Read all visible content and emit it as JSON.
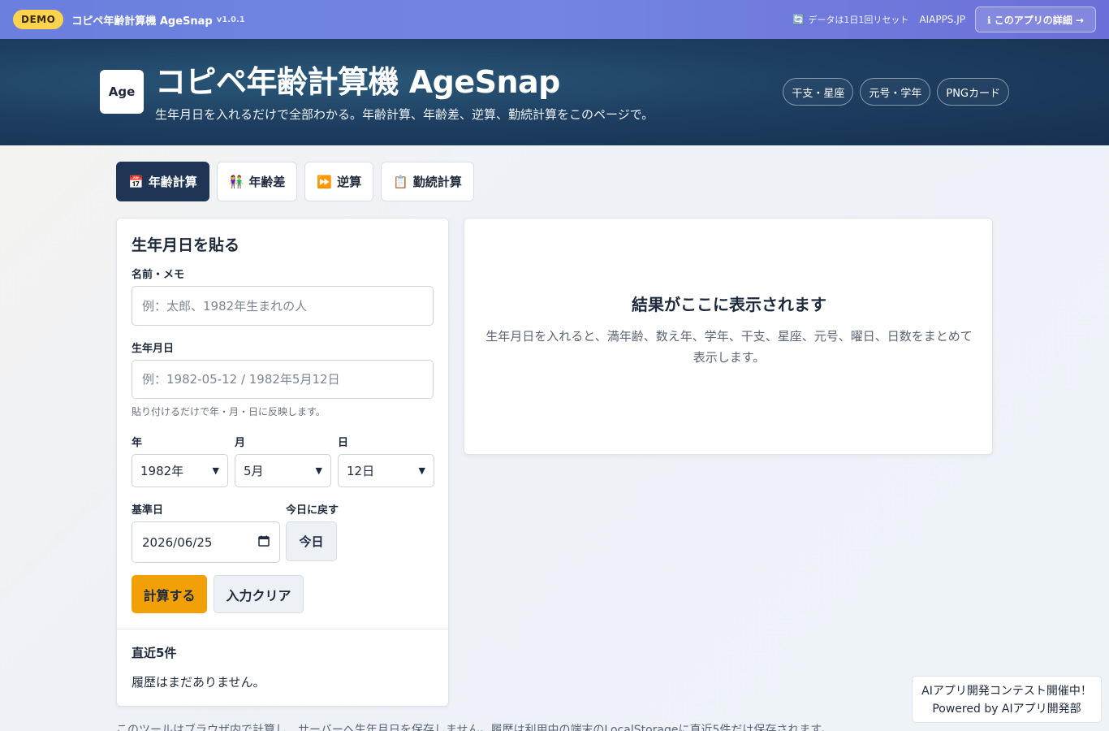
{
  "topbar": {
    "demo": "DEMO",
    "title": "コピペ年齢計算機 AgeSnap",
    "version": "v1.0.1",
    "reset_note": "データは1日1回リセット",
    "reset_icon": "🔄",
    "site_link": "AIAPPS.JP",
    "detail_button": "ℹ このアプリの詳細 →",
    "gradient_color": "#6a7fde"
  },
  "hero": {
    "logo": "Age",
    "title": "コピペ年齢計算機 AgeSnap",
    "subtitle": "生年月日を入れるだけで全部わかる。年齢計算、年齢差、逆算、勤続計算をこのページで。",
    "pills": [
      "干支・星座",
      "元号・学年",
      "PNGカード"
    ],
    "bg_color": "#1e3f62"
  },
  "tabs": [
    {
      "icon": "📅",
      "label": "年齢計算",
      "active": true
    },
    {
      "icon": "👫",
      "label": "年齢差",
      "active": false
    },
    {
      "icon": "⏩",
      "label": "逆算",
      "active": false
    },
    {
      "icon": "📋",
      "label": "勤続計算",
      "active": false
    }
  ],
  "form": {
    "title": "生年月日を貼る",
    "name_label": "名前・メモ",
    "name_placeholder": "例：太郎、1982年生まれの人",
    "birth_label": "生年月日",
    "birth_placeholder": "例：1982-05-12 / 1982年5月12日",
    "hint": "貼り付けるだけで年・月・日に反映します。",
    "year_label": "年",
    "month_label": "月",
    "day_label": "日",
    "year_value": "1982年",
    "month_value": "5月",
    "day_value": "12日",
    "base_label": "基準日",
    "base_value": "2026/06/25",
    "today_label": "今日に戻す",
    "today_button": "今日",
    "calc_button": "計算する",
    "clear_button": "入力クリア",
    "accent_color": "#f2a007"
  },
  "history": {
    "title": "直近5件",
    "empty": "履歴はまだありません。"
  },
  "result": {
    "title": "結果がここに表示されます",
    "description": "生年月日を入れると、満年齢、数え年、学年、干支、星座、元号、曜日、日数をまとめて表示します。"
  },
  "footer": {
    "note": "このツールはブラウザ内で計算し、サーバーへ生年月日を保存しません。履歴は利用中の端末のLocalStorageに直近5件だけ保存されます。",
    "contest_line1": "AIアプリ開発コンテスト開催中！",
    "contest_line2": "Powered by AIアプリ開発部"
  }
}
